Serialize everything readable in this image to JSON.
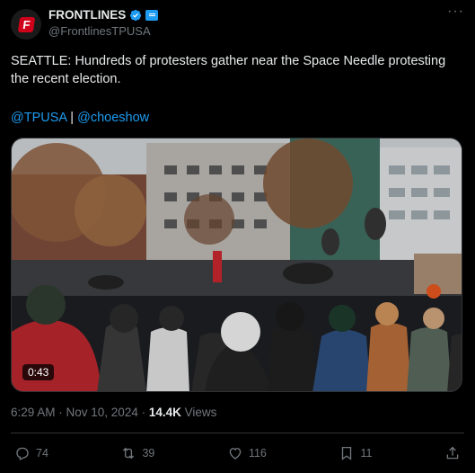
{
  "author": {
    "display_name": "FRONTLINES",
    "handle": "@FrontlinesTPUSA",
    "logo_letter": "F"
  },
  "tweet": {
    "text": "SEATTLE: Hundreds of protesters gather near the Space Needle protesting the recent election.",
    "mention_1": "@TPUSA",
    "separator": "|",
    "mention_2": "@choeshow"
  },
  "video": {
    "duration": "0:43"
  },
  "meta": {
    "timestamp": "6:29 AM · Nov 10, 2024 · ",
    "views_count": "14.4K",
    "views_label": " Views"
  },
  "actions": {
    "replies": "74",
    "reposts": "39",
    "likes": "116",
    "bookmarks": "11"
  },
  "colors": {
    "accent": "#1d9bf0",
    "muted": "#71767b",
    "text": "#e7e9ea",
    "background": "#000000"
  }
}
